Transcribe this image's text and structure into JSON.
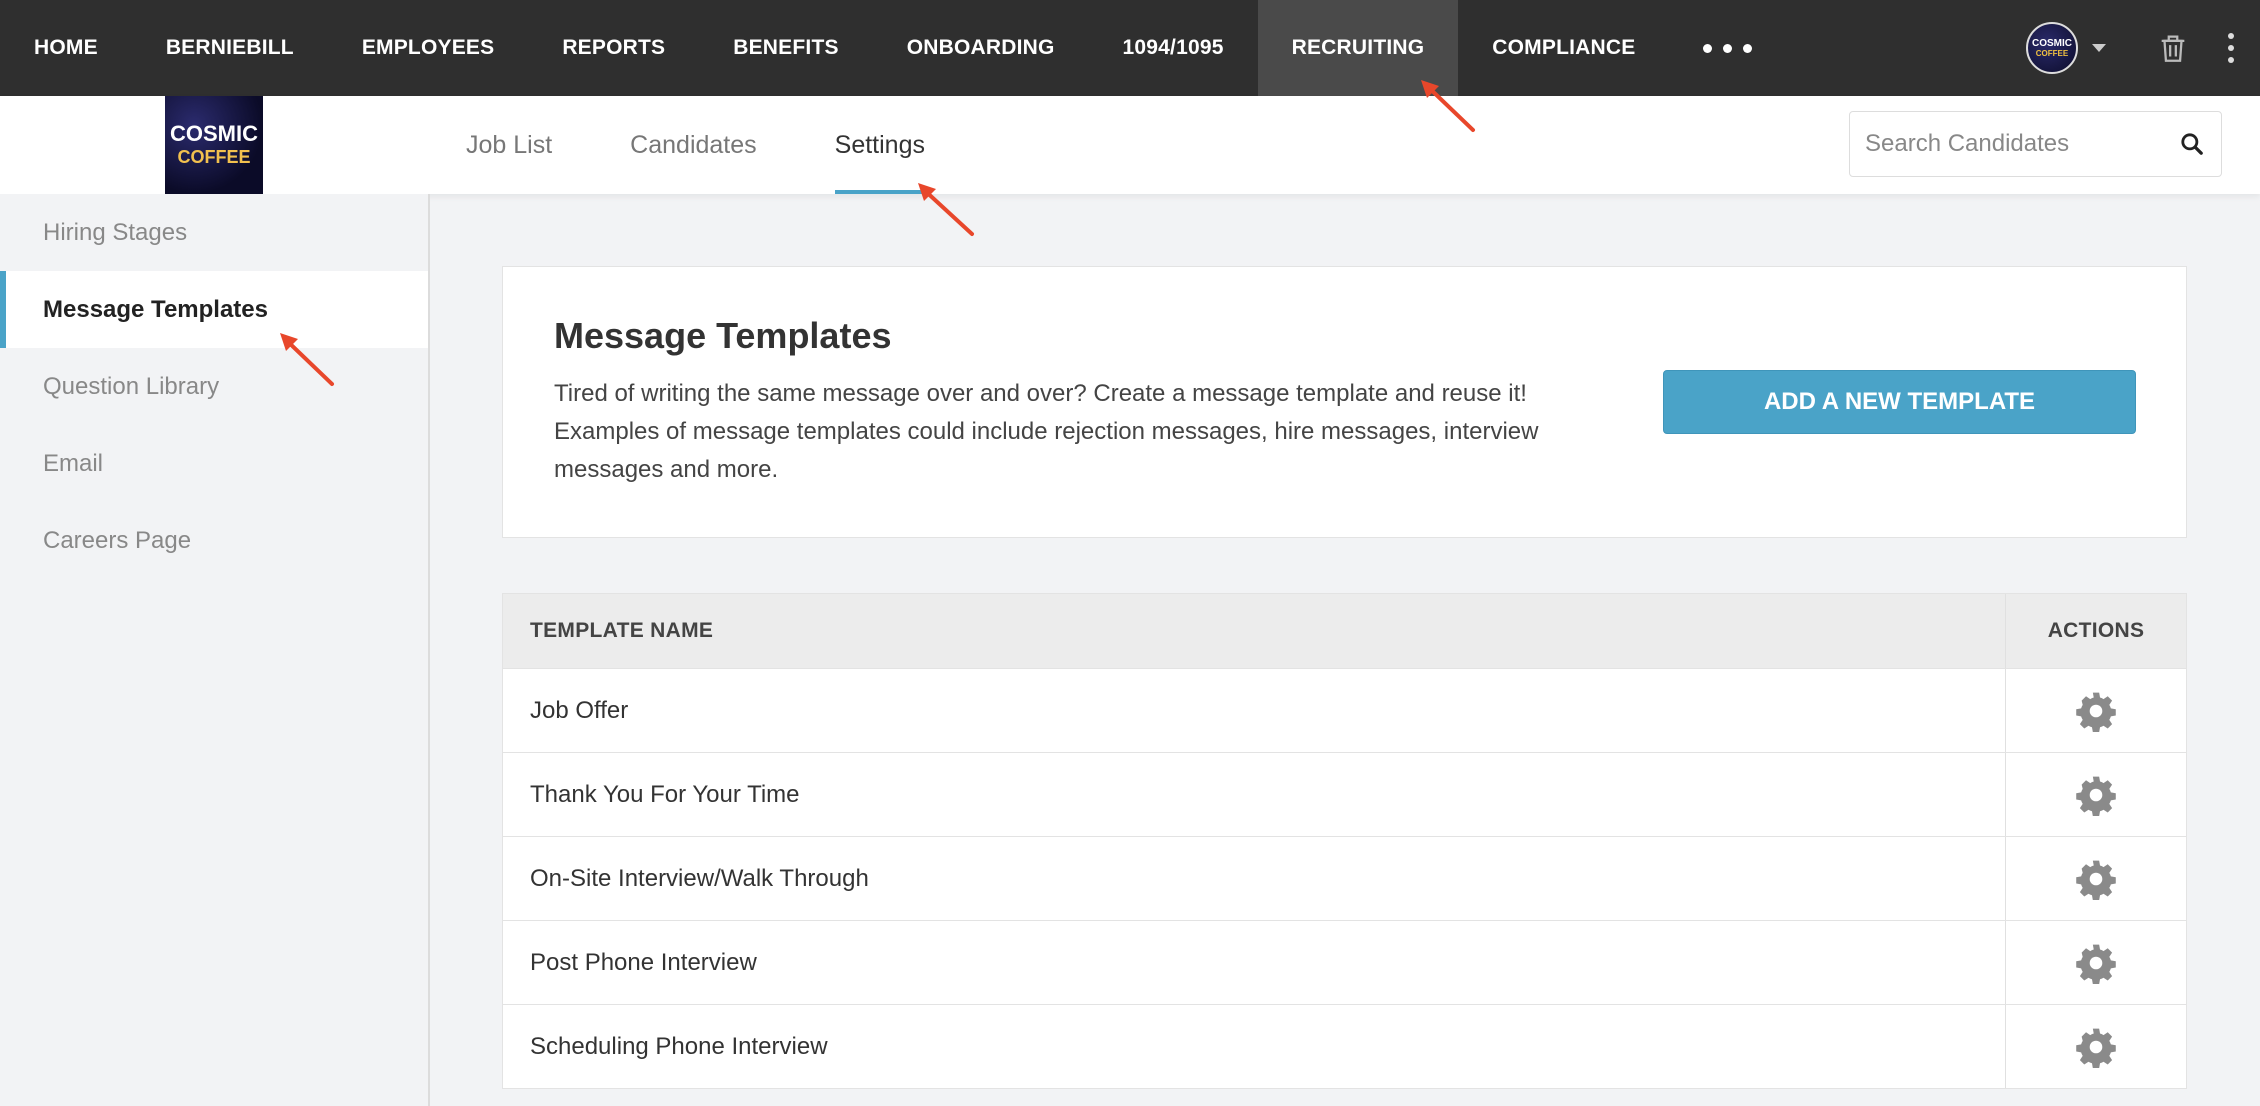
{
  "topnav": {
    "items": [
      "HOME",
      "BERNIEBILL",
      "EMPLOYEES",
      "REPORTS",
      "BENEFITS",
      "ONBOARDING",
      "1094/1095",
      "RECRUITING",
      "COMPLIANCE"
    ],
    "active": "RECRUITING",
    "avatar": {
      "line1": "COSMIC",
      "line2": "COFFEE"
    }
  },
  "logo": {
    "line1": "COSMIC",
    "line2": "COFFEE"
  },
  "tabs": [
    "Job List",
    "Candidates",
    "Settings"
  ],
  "active_tab": "Settings",
  "search": {
    "placeholder": "Search Candidates"
  },
  "sidebar": {
    "items": [
      "Hiring Stages",
      "Message Templates",
      "Question Library",
      "Email",
      "Careers Page"
    ],
    "active": "Message Templates"
  },
  "card": {
    "title": "Message Templates",
    "description": "Tired of writing the same message over and over? Create a message template and reuse it! Examples of message templates could include rejection messages, hire messages, interview messages and more.",
    "button_label": "ADD A NEW TEMPLATE"
  },
  "table": {
    "headers": [
      "TEMPLATE NAME",
      "ACTIONS"
    ],
    "rows": [
      "Job Offer",
      "Thank You For Your Time",
      "On-Site Interview/Walk Through",
      "Post Phone Interview",
      "Scheduling Phone Interview"
    ]
  },
  "colors": {
    "accent": "#4aa3c8",
    "nav_bg": "#2f2f2f",
    "annotation_arrow": "#e8472b"
  }
}
